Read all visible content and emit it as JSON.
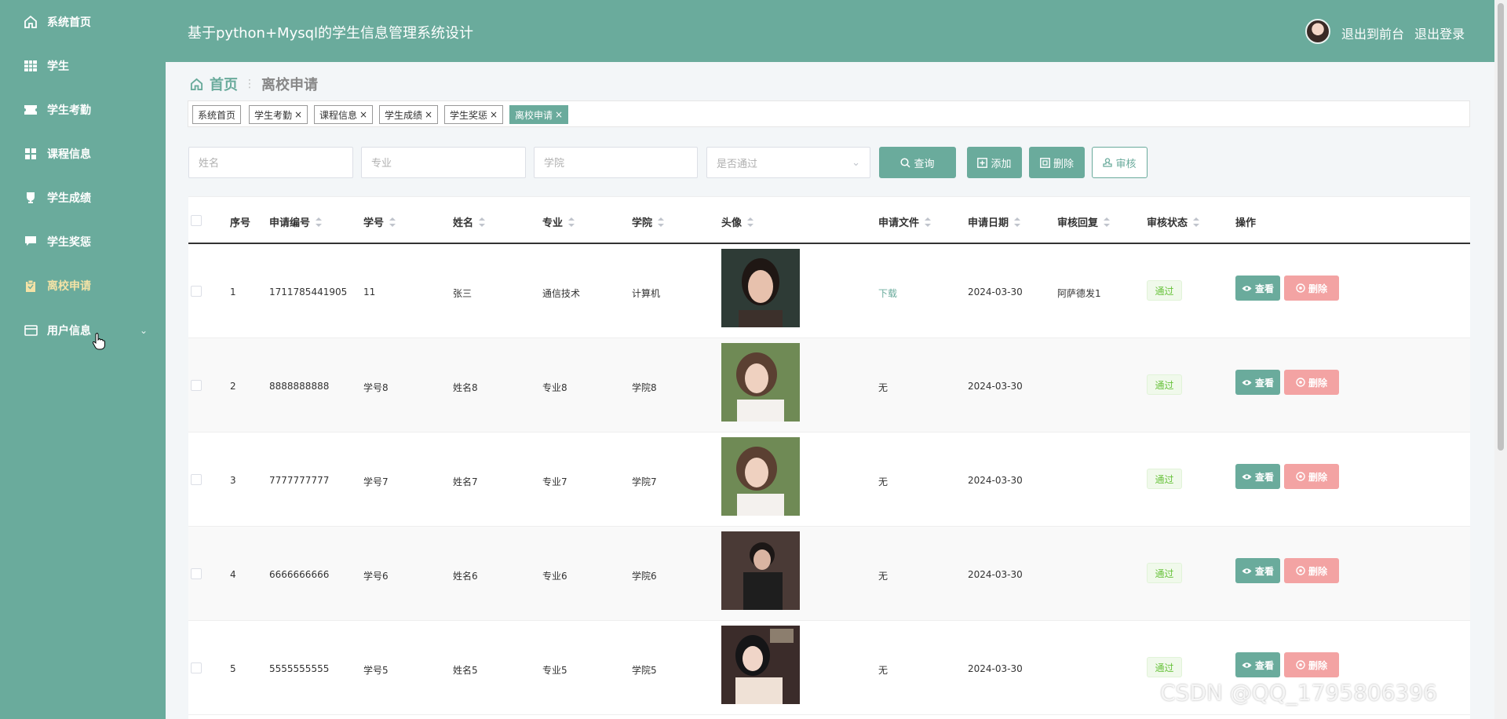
{
  "sidebar": {
    "items": [
      {
        "label": "系统首页",
        "icon": "home-icon"
      },
      {
        "label": "学生",
        "icon": "grid-icon"
      },
      {
        "label": "学生考勤",
        "icon": "ticket-icon"
      },
      {
        "label": "课程信息",
        "icon": "apps-icon"
      },
      {
        "label": "学生成绩",
        "icon": "trophy-icon"
      },
      {
        "label": "学生奖惩",
        "icon": "chat-icon"
      },
      {
        "label": "离校申请",
        "icon": "clipboard-icon"
      },
      {
        "label": "用户信息",
        "icon": "card-icon"
      }
    ]
  },
  "header": {
    "title": "基于python+Mysql的学生信息管理系统设计",
    "back_link": "退出到前台",
    "logout_link": "退出登录"
  },
  "breadcrumb": {
    "home": "首页",
    "current": "离校申请"
  },
  "tags": [
    {
      "label": "系统首页"
    },
    {
      "label": "学生考勤"
    },
    {
      "label": "课程信息"
    },
    {
      "label": "学生成绩"
    },
    {
      "label": "学生奖惩"
    },
    {
      "label": "离校申请"
    }
  ],
  "filters": {
    "name_placeholder": "姓名",
    "major_placeholder": "专业",
    "college_placeholder": "学院",
    "passed_placeholder": "是否通过",
    "search_label": "查询",
    "add_label": "添加",
    "delete_label": "删除",
    "review_label": "审核"
  },
  "table": {
    "columns": [
      "序号",
      "申请编号",
      "学号",
      "姓名",
      "专业",
      "学院",
      "头像",
      "申请文件",
      "申请日期",
      "审核回复",
      "审核状态",
      "操作"
    ],
    "view_label": "查看",
    "delete_label": "删除",
    "rows": [
      {
        "index": "1",
        "app_no": "1711785441905",
        "student_no": "11",
        "name": "张三",
        "major": "通信技术",
        "college": "计算机",
        "file": "下载",
        "date": "2024-03-30",
        "reply": "阿萨德发1",
        "status": "通过"
      },
      {
        "index": "2",
        "app_no": "8888888888",
        "student_no": "学号8",
        "name": "姓名8",
        "major": "专业8",
        "college": "学院8",
        "file": "无",
        "date": "2024-03-30",
        "reply": "",
        "status": "通过"
      },
      {
        "index": "3",
        "app_no": "7777777777",
        "student_no": "学号7",
        "name": "姓名7",
        "major": "专业7",
        "college": "学院7",
        "file": "无",
        "date": "2024-03-30",
        "reply": "",
        "status": "通过"
      },
      {
        "index": "4",
        "app_no": "6666666666",
        "student_no": "学号6",
        "name": "姓名6",
        "major": "专业6",
        "college": "学院6",
        "file": "无",
        "date": "2024-03-30",
        "reply": "",
        "status": "通过"
      },
      {
        "index": "5",
        "app_no": "5555555555",
        "student_no": "学号5",
        "name": "姓名5",
        "major": "专业5",
        "college": "学院5",
        "file": "无",
        "date": "2024-03-30",
        "reply": "",
        "status": "通过"
      }
    ]
  },
  "watermark": "CSDN @QQ_1795806396"
}
